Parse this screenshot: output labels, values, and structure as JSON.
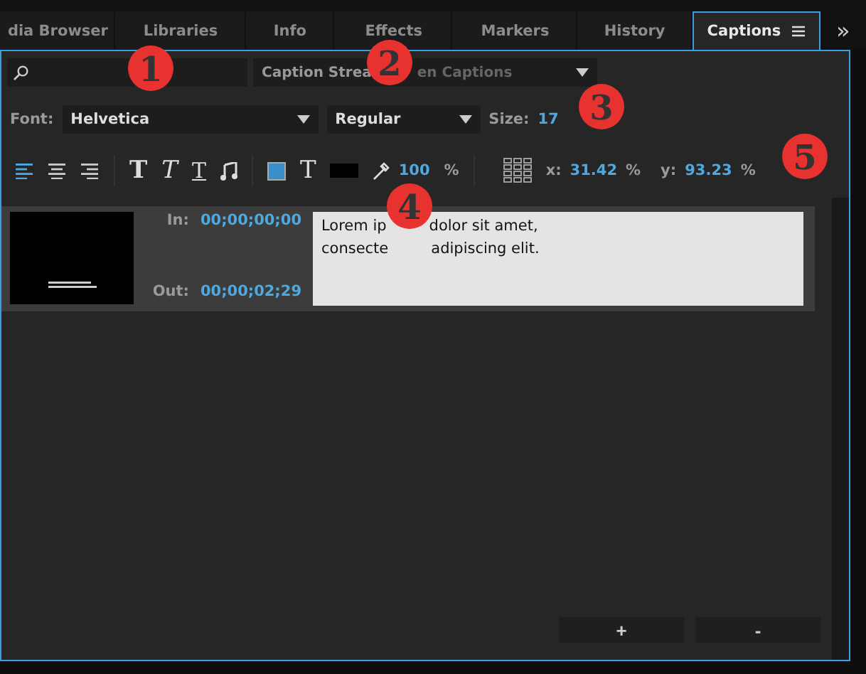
{
  "tabs": [
    {
      "label": "dia Browser",
      "selected": false
    },
    {
      "label": "Libraries",
      "selected": false
    },
    {
      "label": "Info",
      "selected": false
    },
    {
      "label": "Effects",
      "selected": false
    },
    {
      "label": "Markers",
      "selected": false
    },
    {
      "label": "History",
      "selected": false
    },
    {
      "label": "Captions",
      "selected": true
    }
  ],
  "overflow": "»",
  "stream": {
    "parts": [
      "Caption Strea",
      "en Captions"
    ]
  },
  "font": {
    "label": "Font:",
    "value": "Helvetica"
  },
  "style": {
    "value": "Regular"
  },
  "size": {
    "label": "Size:",
    "value": "17"
  },
  "align": [
    {
      "kind": "left",
      "selected": true
    },
    {
      "kind": "center",
      "selected": false
    },
    {
      "kind": "right",
      "selected": false
    }
  ],
  "format": [
    {
      "kind": "bold",
      "label": "T"
    },
    {
      "kind": "italic",
      "label": "T"
    },
    {
      "kind": "underline",
      "label": "T"
    }
  ],
  "text_color": {
    "label": "T"
  },
  "opacity": {
    "value": "100",
    "unit": "%"
  },
  "position": [
    {
      "label": "x:",
      "value": "31.42",
      "unit": "%"
    },
    {
      "label": "y:",
      "value": "93.23",
      "unit": "%"
    }
  ],
  "captions": [
    {
      "in_label": "In:",
      "in": "00;00;00;00",
      "out_label": "Out:",
      "out": "00;00;02;29",
      "lines": [
        [
          "Lorem ip",
          "dolor sit amet,"
        ],
        [
          "consecte",
          "adipiscing elit."
        ]
      ]
    }
  ],
  "buttons": [
    "+",
    "-"
  ],
  "callouts": [
    "1",
    "2",
    "3",
    "4",
    "5"
  ]
}
